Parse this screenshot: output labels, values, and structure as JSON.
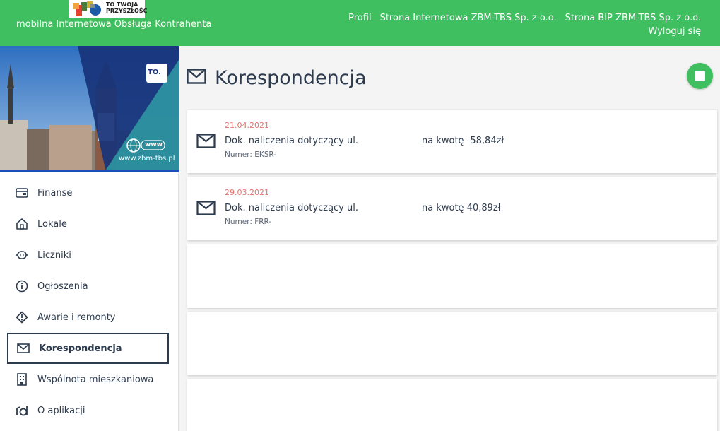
{
  "header": {
    "logo_text_line1": "TO TWOJA",
    "logo_text_line2": "PRZYSZŁOŚĆ",
    "app_title": "mobilna Internetowa Obsługa Kontrahenta",
    "nav": [
      "Profil",
      "Strona Internetowa ZBM-TBS Sp. z o.o.",
      "Strona BIP ZBM-TBS Sp. z o.o."
    ],
    "logout_label": "Wyloguj się"
  },
  "banner": {
    "badge": "TO.",
    "www_label": "www",
    "url": "www.zbm-tbs.pl"
  },
  "sidebar": {
    "items": [
      {
        "label": "Finanse",
        "icon": "wallet-icon"
      },
      {
        "label": "Lokale",
        "icon": "home-icon"
      },
      {
        "label": "Liczniki",
        "icon": "meter-icon"
      },
      {
        "label": "Ogłoszenia",
        "icon": "info-icon"
      },
      {
        "label": "Awarie i remonty",
        "icon": "alert-icon"
      },
      {
        "label": "Korespondencja",
        "icon": "envelope-icon",
        "active": true
      },
      {
        "label": "Wspólnota mieszkaniowa",
        "icon": "building-icon"
      },
      {
        "label": "O aplikacji",
        "icon": "about-icon"
      }
    ]
  },
  "main": {
    "title": "Korespondencja",
    "title_icon": "envelope-icon",
    "fab_icon": "stop-icon",
    "letters": [
      {
        "date": "21.04.2021",
        "title": "Dok. naliczenia dotyczący ul.",
        "amount": "na kwotę -58,84zł",
        "number": "Numer: EKSR-"
      },
      {
        "date": "29.03.2021",
        "title": "Dok. naliczenia dotyczący ul.",
        "amount": "na kwotę 40,89zł",
        "number": "Numer: FRR-"
      }
    ]
  },
  "colors": {
    "brand_green": "#3fbf5f",
    "text_dark": "#2d3b4e",
    "date_red": "#e2756b",
    "banner_blue": "#1a4fb8"
  }
}
